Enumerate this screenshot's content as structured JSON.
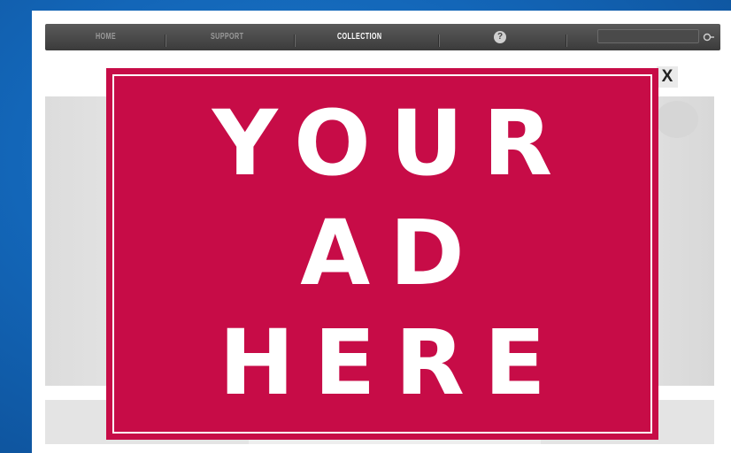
{
  "navbar": {
    "items": [
      {
        "label": "HOME",
        "active": false
      },
      {
        "label": "SUPPORT",
        "active": false
      },
      {
        "label": "COLLECTION",
        "active": true
      }
    ],
    "help_icon": "question-mark-icon",
    "search": {
      "value": "",
      "placeholder": ""
    },
    "search_icon": "magnifier-icon"
  },
  "ad": {
    "lines": [
      "YOUR",
      "AD",
      "HERE"
    ],
    "background_color": "#c70c47",
    "text_color": "#ffffff"
  },
  "close_button": {
    "label": "X",
    "icon": "close-icon"
  },
  "colors": {
    "desktop_background": "#1366b8",
    "navbar": "#4a4a4a",
    "page": "#ffffff"
  }
}
